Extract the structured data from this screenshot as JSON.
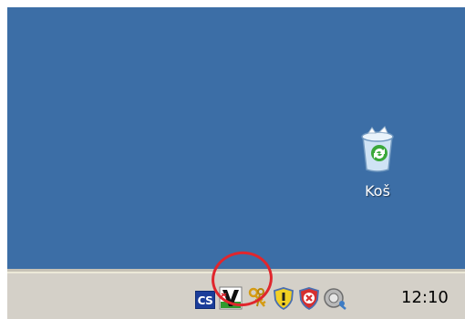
{
  "desktop": {
    "recycle_bin_label": "Koš",
    "background_color": "#3c6ea6"
  },
  "taskbar": {
    "language_indicator": "CS",
    "clock": "12:10",
    "tray_icons": [
      "antivirus-v-icon",
      "network-keys-icon",
      "security-shield-icon",
      "security-alert-shield-icon",
      "volume-icon"
    ]
  },
  "colors": {
    "taskbar": "#d4d0c8",
    "highlight_ring": "#e0262d"
  }
}
